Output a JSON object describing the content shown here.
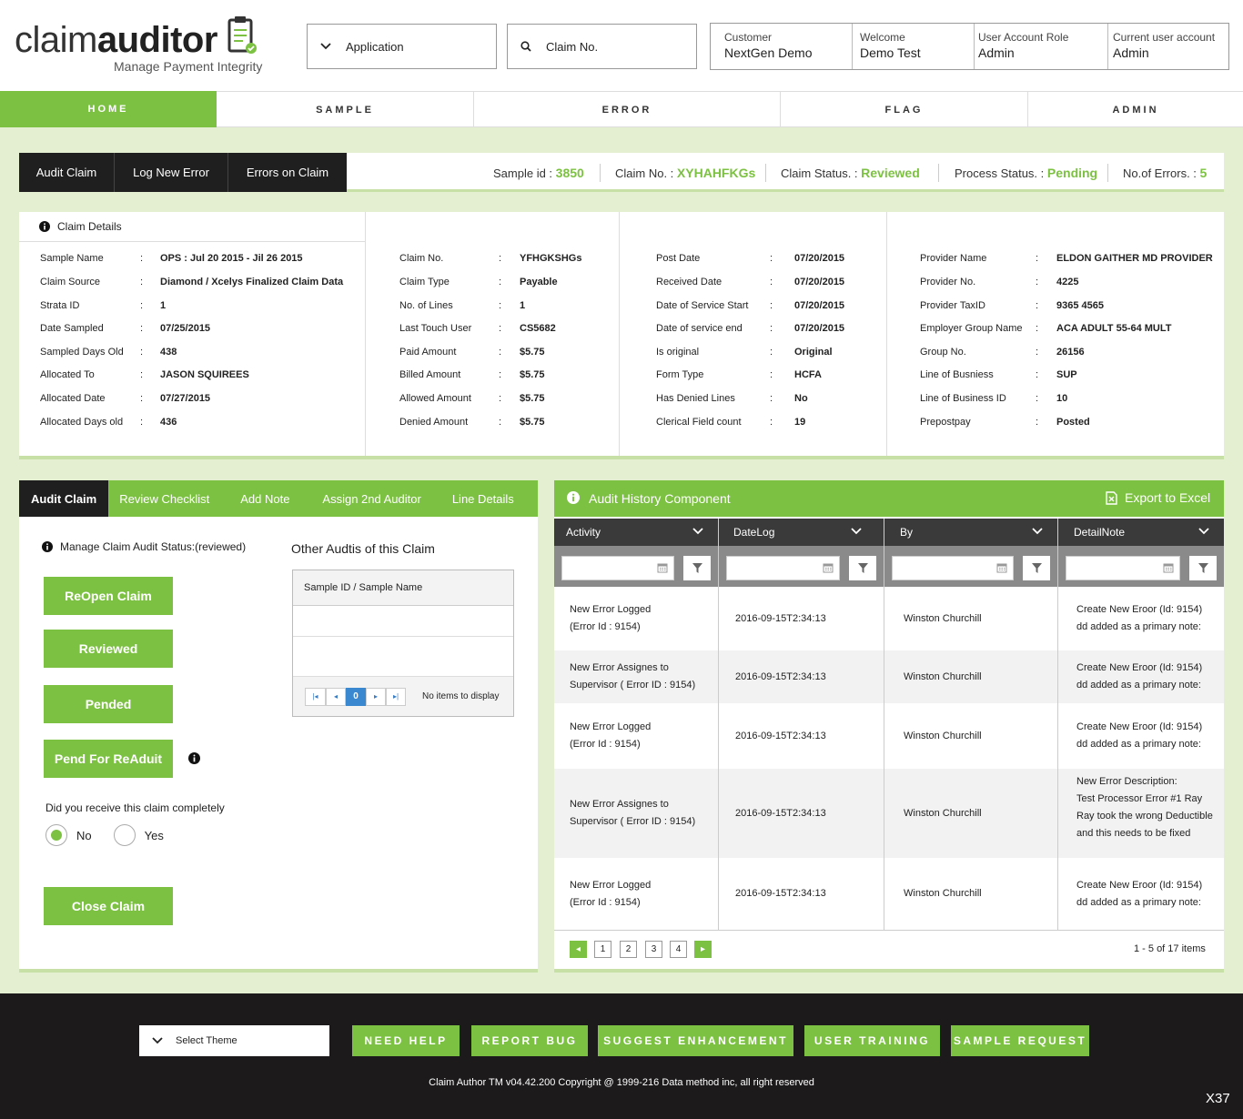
{
  "header": {
    "logo_light": "claim",
    "logo_bold": "auditor",
    "logo_tagline": "Manage Payment Integrity",
    "application_label": "Application",
    "claim_search_placeholder": "Claim No.",
    "customer_label": "Customer",
    "customer_value": "NextGen Demo",
    "welcome_label": "Welcome",
    "welcome_value": "Demo Test",
    "role_label": "User Account Role",
    "role_value": "Admin",
    "current_label": "Current user account",
    "current_value": "Admin"
  },
  "nav": [
    "HOME",
    "SAMPLE",
    "ERROR",
    "FLAG",
    "ADMIN"
  ],
  "claim_tabs": [
    "Audit Claim",
    "Log New Error",
    "Errors on Claim"
  ],
  "status_bar": {
    "sample_id_label": "Sample id :",
    "sample_id": "3850",
    "claim_no_label": "Claim No. :",
    "claim_no": "XYHAHFKGs",
    "claim_status_label": "Claim Status. :",
    "claim_status": "Reviewed",
    "process_status_label": "Process Status. :",
    "process_status": "Pending",
    "errors_label": "No.of Errors. :",
    "errors": "5"
  },
  "claim_details": {
    "title": "Claim Details",
    "col1": [
      {
        "k": "Sample Name",
        "v": "OPS : Jul 20 2015 - Jil 26 2015"
      },
      {
        "k": "Claim Source",
        "v": "Diamond / Xcelys Finalized Claim Data"
      },
      {
        "k": "Strata ID",
        "v": "1"
      },
      {
        "k": "Date Sampled",
        "v": "07/25/2015"
      },
      {
        "k": "Sampled Days Old",
        "v": "438"
      },
      {
        "k": "Allocated To",
        "v": "JASON SQUIREES"
      },
      {
        "k": "Allocated Date",
        "v": "07/27/2015"
      },
      {
        "k": "Allocated Days old",
        "v": "436"
      }
    ],
    "col2": [
      {
        "k": "Claim No.",
        "v": "YFHGKSHGs"
      },
      {
        "k": "Claim Type",
        "v": "Payable"
      },
      {
        "k": "No. of Lines",
        "v": "1"
      },
      {
        "k": "Last Touch User",
        "v": "CS5682"
      },
      {
        "k": "Paid Amount",
        "v": "$5.75"
      },
      {
        "k": "Billed Amount",
        "v": "$5.75"
      },
      {
        "k": "Allowed Amount",
        "v": "$5.75"
      },
      {
        "k": "Denied Amount",
        "v": "$5.75"
      }
    ],
    "col3": [
      {
        "k": "Post Date",
        "v": "07/20/2015"
      },
      {
        "k": "Received Date",
        "v": "07/20/2015"
      },
      {
        "k": "Date of Service Start",
        "v": "07/20/2015"
      },
      {
        "k": "Date of service end",
        "v": "07/20/2015"
      },
      {
        "k": "Is original",
        "v": "Original"
      },
      {
        "k": "Form Type",
        "v": "HCFA"
      },
      {
        "k": "Has Denied Lines",
        "v": "No"
      },
      {
        "k": "Clerical Field count",
        "v": "19"
      }
    ],
    "col4": [
      {
        "k": "Provider Name",
        "v": "ELDON GAITHER MD PROVIDER"
      },
      {
        "k": "Provider No.",
        "v": "4225"
      },
      {
        "k": "Provider TaxID",
        "v": "9365 4565"
      },
      {
        "k": "Employer Group Name",
        "v": "ACA ADULT 55-64 MULT"
      },
      {
        "k": "Group No.",
        "v": "26156"
      },
      {
        "k": "Line of Busniess",
        "v": "SUP"
      },
      {
        "k": "Line of Business ID",
        "v": "10"
      },
      {
        "k": "Prepostpay",
        "v": "Posted"
      }
    ]
  },
  "audit_tabs": [
    "Audit Claim",
    "Review Checklist",
    "Add Note",
    "Assign 2nd Auditor",
    "Line Details"
  ],
  "audit": {
    "manage_status": "Manage Claim Audit Status:(reviewed)",
    "buttons": [
      "ReOpen Claim",
      "Reviewed",
      "Pended",
      "Pend For ReAduit"
    ],
    "question": "Did you receive  this claim completely",
    "radio_no": "No",
    "radio_yes": "Yes",
    "close_button": "Close Claim",
    "other_title": "Other Audtis of this Claim",
    "other_header": "Sample ID /  Sample Name",
    "pager_page": "0",
    "no_items": "No items to display"
  },
  "history": {
    "title": "Audit History Component",
    "export": "Export to Excel",
    "columns": [
      "Activity",
      "DateLog",
      "By",
      "DetailNote"
    ],
    "rows": [
      {
        "activity": [
          "New Error Logged",
          "(Error Id : 9154)"
        ],
        "date": "2016-09-15T2:34:13",
        "by": "Winston Churchill",
        "note": [
          "Create New Eroor (Id: 9154)",
          "dd added as a primary note:"
        ]
      },
      {
        "activity": [
          "New Error Assignes to",
          "Supervisor ( Error ID : 9154)"
        ],
        "date": "2016-09-15T2:34:13",
        "by": "Winston Churchill",
        "note": [
          "Create New Eroor (Id: 9154)",
          "dd added as a primary note:"
        ]
      },
      {
        "activity": [
          "New Error Logged",
          "(Error Id : 9154)"
        ],
        "date": "2016-09-15T2:34:13",
        "by": "Winston Churchill",
        "note": [
          "Create New Eroor (Id: 9154)",
          "dd added as a primary note:"
        ]
      },
      {
        "activity": [
          "New Error Assignes to",
          "Supervisor ( Error ID : 9154)"
        ],
        "date": "2016-09-15T2:34:13",
        "by": "Winston Churchill",
        "note": [
          "New Error Description:",
          "Test Processor Error #1 Ray",
          "Ray took the wrong Deductible",
          "and this needs to be fixed"
        ]
      },
      {
        "activity": [
          "New Error Logged",
          "(Error Id : 9154)"
        ],
        "date": "2016-09-15T2:34:13",
        "by": "Winston Churchill",
        "note": [
          "Create New Eroor (Id: 9154)",
          "dd added as a primary note:"
        ]
      }
    ],
    "pages": [
      "1",
      "2",
      "3",
      "4"
    ],
    "summary": "1 - 5  of 17 items"
  },
  "footer": {
    "theme_label": "Select Theme",
    "buttons": [
      "NEED HELP",
      "REPORT  BUG",
      "SUGGEST ENHANCEMENT",
      "USER TRAINING",
      "SAMPLE REQUEST"
    ],
    "copyright": "Claim Author TM v04.42.200 Copyright @ 1999-216 Data method inc, all right reserved",
    "corner": "X37"
  },
  "colors": {
    "accent": "#7cc142",
    "dark": "#1f1f1f",
    "background": "#e4efd2"
  }
}
